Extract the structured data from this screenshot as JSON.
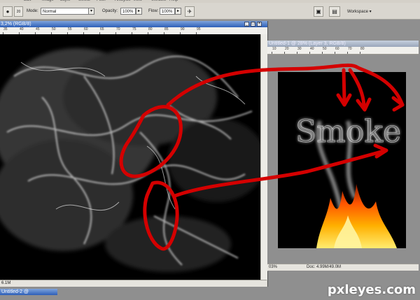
{
  "menu": {
    "items": [
      "Edit",
      "Image",
      "Layer",
      "Select",
      "Filter",
      "Analysis",
      "View",
      "Window",
      "Help"
    ]
  },
  "options": {
    "mode_label": "Mode:",
    "mode_value": "Normal",
    "opacity_label": "Opacity:",
    "opacity_value": "100%",
    "flow_label": "Flow:",
    "flow_value": "100%",
    "workspace_label": "Workspace ▾",
    "brush_size": "20"
  },
  "window_left": {
    "title": "3,2% (RGB/8)",
    "status": "6.1M",
    "ruler_ticks": [
      "35",
      "40",
      "45",
      "50",
      "55",
      "60",
      "65",
      "70",
      "75",
      "80",
      "85",
      "90",
      "95"
    ]
  },
  "window_right": {
    "title": "Untitled-1 @ 28% (Layer 3, RGB/8)",
    "zoom": "03%",
    "doc": "Doc: 4.99M/49.0M",
    "ruler_ticks": [
      "10",
      "20",
      "30",
      "40",
      "50",
      "60",
      "70",
      "80"
    ],
    "text": "Smoke"
  },
  "window_bottom": {
    "title": "Untitled-2 @"
  },
  "watermark": "pxleyes.com",
  "colors": {
    "title_active": "#2d5fb8",
    "canvas": "#000000",
    "annotation": "#d40000",
    "workspace_bg": "#8f8f8f"
  }
}
